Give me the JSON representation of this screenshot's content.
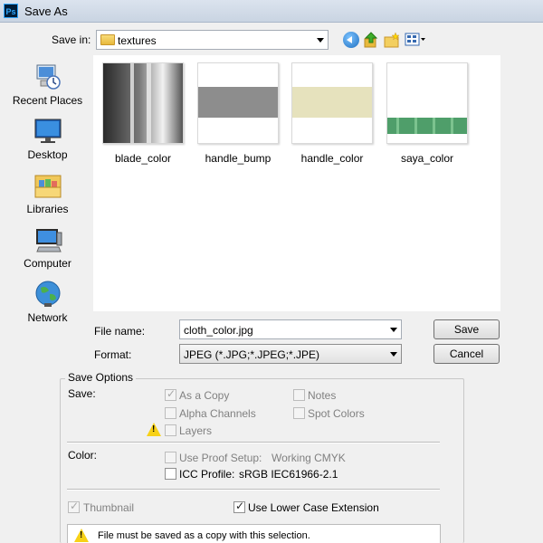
{
  "window": {
    "app_icon": "Ps",
    "title": "Save As"
  },
  "save_in": {
    "label": "Save in:",
    "value": "textures",
    "icon": "folder-icon"
  },
  "toolbar": {
    "icons": [
      "back-icon",
      "up-one-level-icon",
      "new-folder-icon",
      "views-menu-icon"
    ]
  },
  "places": [
    {
      "label": "Recent Places",
      "icon": "recent-places-icon"
    },
    {
      "label": "Desktop",
      "icon": "desktop-icon"
    },
    {
      "label": "Libraries",
      "icon": "libraries-icon"
    },
    {
      "label": "Computer",
      "icon": "computer-icon"
    },
    {
      "label": "Network",
      "icon": "network-icon"
    }
  ],
  "files": [
    {
      "name": "blade_color",
      "thumb": "blade-color-thumbnail"
    },
    {
      "name": "handle_bump",
      "thumb": "handle-bump-thumbnail"
    },
    {
      "name": "handle_color",
      "thumb": "handle-color-thumbnail"
    },
    {
      "name": "saya_color",
      "thumb": "saya-color-thumbnail"
    }
  ],
  "file_name": {
    "label": "File name:",
    "value": "cloth_color.jpg"
  },
  "format": {
    "label": "Format:",
    "value": "JPEG (*.JPG;*.JPEG;*.JPE)"
  },
  "buttons": {
    "save": "Save",
    "cancel": "Cancel"
  },
  "save_options": {
    "title": "Save Options",
    "save_label": "Save:",
    "as_a_copy": {
      "label": "As a Copy",
      "checked": true,
      "enabled": false
    },
    "notes": {
      "label": "Notes",
      "checked": false,
      "enabled": false
    },
    "alpha_channels": {
      "label": "Alpha Channels",
      "checked": false,
      "enabled": false
    },
    "spot_colors": {
      "label": "Spot Colors",
      "checked": false,
      "enabled": false
    },
    "layers": {
      "label": "Layers",
      "checked": false,
      "enabled": false
    },
    "color_label": "Color:",
    "use_proof_setup": {
      "label": "Use Proof Setup:",
      "profile": "Working CMYK",
      "checked": false,
      "enabled": false
    },
    "icc_profile": {
      "label": "ICC Profile:",
      "profile": "sRGB IEC61966-2.1",
      "checked": false,
      "enabled": true
    },
    "thumbnail": {
      "label": "Thumbnail",
      "checked": true,
      "enabled": false
    },
    "lower_case_ext": {
      "label": "Use Lower Case Extension",
      "checked": true,
      "enabled": true
    },
    "notice": "File must be saved as a copy with this selection."
  },
  "colors": {
    "warning": "#f7d117",
    "window_bg": "#f0f0f0"
  }
}
